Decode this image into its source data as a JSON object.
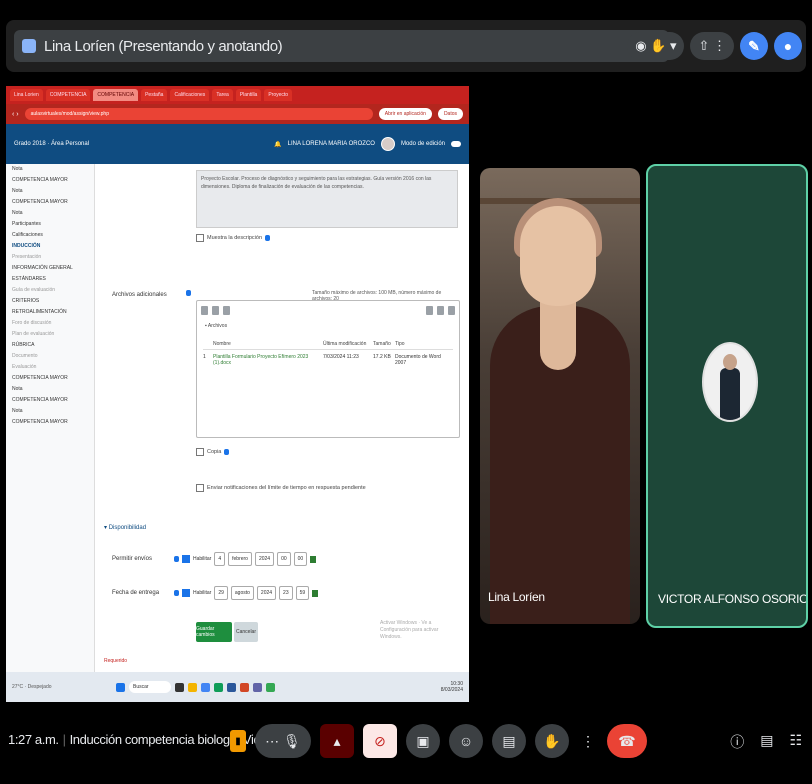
{
  "top_bar": {
    "title": "Lina Loríen (Presentando y anotando)",
    "right_pill_1": "◉ ✋ ▾",
    "right_pill_2": "⇧ ⋮",
    "right_circle_1": "✎",
    "right_circle_2": "●"
  },
  "browser": {
    "tabs": [
      "Lina Lorien",
      "COMPETENCIA",
      "COMPETENCIA",
      "Pestaña",
      "Calificaciones",
      "Tarea",
      "Plantilla",
      "Proyecto"
    ],
    "active_tab_index": 2,
    "address": "aulasvirtuales/mod/assign/view.php",
    "address_pill": "Abrir en aplicación",
    "address_pill_2": "Datos"
  },
  "moodle": {
    "header_left": "Grado 2018 · Área Personal",
    "header_user": "LINA LORENA MARIA OROZCO",
    "header_right": "Modo de edición",
    "sidebar_items": [
      {
        "label": "Nota",
        "state": "normal"
      },
      {
        "label": "COMPETENCIA MAYOR",
        "state": "normal"
      },
      {
        "label": "Nota",
        "state": "normal"
      },
      {
        "label": "COMPETENCIA MAYOR",
        "state": "normal"
      },
      {
        "label": "Nota",
        "state": "normal"
      },
      {
        "label": "Participantes",
        "state": "normal"
      },
      {
        "label": "Calificaciones",
        "state": "normal"
      },
      {
        "label": "INDUCCIÓN",
        "state": "active"
      },
      {
        "label": "Presentación",
        "state": "muted"
      },
      {
        "label": "INFORMACIÓN GENERAL",
        "state": "normal"
      },
      {
        "label": "ESTÁNDARES",
        "state": "normal"
      },
      {
        "label": "Guía de evaluación",
        "state": "muted"
      },
      {
        "label": "CRITERIOS",
        "state": "normal"
      },
      {
        "label": "RETROALIMENTACIÓN",
        "state": "normal"
      },
      {
        "label": "Foro de discusión",
        "state": "muted"
      },
      {
        "label": "Plan de evaluación",
        "state": "muted"
      },
      {
        "label": "RÚBRICA",
        "state": "normal"
      },
      {
        "label": "Documento",
        "state": "muted"
      },
      {
        "label": "Evaluación",
        "state": "muted"
      },
      {
        "label": "COMPETENCIA MAYOR",
        "state": "normal"
      },
      {
        "label": "Nota",
        "state": "normal"
      },
      {
        "label": "COMPETENCIA MAYOR",
        "state": "normal"
      },
      {
        "label": "Nota",
        "state": "normal"
      },
      {
        "label": "COMPETENCIA MAYOR",
        "state": "normal"
      }
    ],
    "desc_text": "Proyecto Escolar. Proceso de diagnóstico y seguimiento para las estrategias. Guía versión 2016 con las dimensiones. Diploma de finalización de evaluación de las competencias.",
    "display_desc_label": "Muestra la descripción",
    "files_label": "Archivos adicionales",
    "files_limit": "Tamaño máximo de archivos: 100 MB, número máximo de archivos: 20",
    "files_folder": "Archivos",
    "file_headers": [
      "Nombre",
      "Última modificación",
      "Tamaño",
      "Tipo"
    ],
    "file_row": {
      "index": "1",
      "name": "Plantilla Formulario Proyecto Efímero 2023 (1).docx",
      "date": "7/03/2024 11:23",
      "size": "17.2 KB",
      "type": "Documento de Word 2007"
    },
    "optional_label": "Copia",
    "notify_label": "Enviar notificaciones del límite de tiempo en respuesta pendiente",
    "availability_header": "Disponibilidad",
    "allow_label": "Permitir envíos",
    "due_label": "Fecha de entrega",
    "enable_label": "Habilitar",
    "row1": {
      "day": "4",
      "month": "febrero",
      "year": "2024",
      "hour": "00",
      "minute": "00"
    },
    "row2": {
      "day": "29",
      "month": "agosto",
      "year": "2024",
      "hour": "23",
      "minute": "59"
    },
    "save_button": "Guardar cambios",
    "cancel_button": "Cancelar",
    "footer_hint": "Activar Windows · Ve a Configuración para activar Windows.",
    "requirements_label": "Requerido"
  },
  "taskbar": {
    "weather": "27°C · Despejado",
    "search": "Buscar",
    "tray_time": "10:30",
    "tray_date": "8/03/2024"
  },
  "participants": [
    {
      "name": "Lina Loríen"
    },
    {
      "name": "VICTOR ALFONSO OSORIO ACE..."
    }
  ],
  "bottom_bar": {
    "time": "1:27 a.m.",
    "meeting": "Inducción competencia biologia-Victor ..."
  },
  "colors": {
    "accent_green": "#5ed1a7",
    "hangup_red": "#ea4335",
    "moodle_blue": "#0f4c81"
  }
}
